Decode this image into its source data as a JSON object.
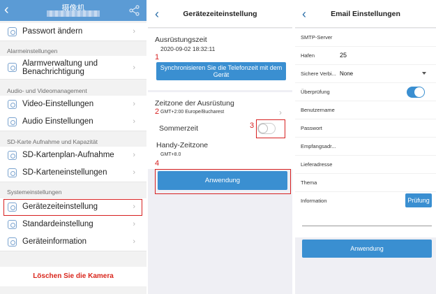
{
  "camera_settings": {
    "header": {
      "title": "摄像机",
      "back_icon": "chevron-left-icon",
      "share_icon": "share-icon",
      "color": "#5b9bd5"
    },
    "change_password": "Passwort ändern",
    "sections": {
      "alarm": "Alarmeinstellungen",
      "av": "Audio- und Videomanagement",
      "sd": "SD-Karte Aufnahme und Kapazität",
      "system": "Systemeinstellungen"
    },
    "items": {
      "alarm_management": "Alarmverwaltung und Benachrichtigung",
      "video_settings": "Video-Einstellungen",
      "audio_settings": "Audio Einstellungen",
      "sd_recording_plan": "SD-Kartenplan-Aufnahme",
      "sd_card_settings": "SD-Karteneinstellungen",
      "device_time_setting": "Gerätezeiteinstellung",
      "default_setting": "Standardeinstellung",
      "device_info": "Geräteinformation"
    },
    "delete_camera": "Löschen Sie die Kamera"
  },
  "device_time": {
    "header": {
      "title": "Gerätezeiteinstellung"
    },
    "equipment_time_label": "Ausrüstungszeit",
    "equipment_time_value": "2020-09-02 18:32:11",
    "sync_button": "Synchronisieren Sie die Telefonzeit mit dem Gerät",
    "timezone_label": "Zeitzone der Ausrüstung",
    "timezone_value": "GMT+2:00 Europe/Bucharest",
    "dst_label": "Sommerzeit",
    "dst_on": false,
    "phone_timezone_label": "Handy-Zeitzone",
    "phone_timezone_value": "GMT+8.0",
    "apply_button": "Anwendung",
    "markers": [
      "1",
      "2",
      "3",
      "4"
    ],
    "accent_color": "#3a8fd1",
    "marker_color": "#d72020"
  },
  "email_settings": {
    "header": {
      "title": "Email Einstellungen"
    },
    "fields": {
      "smtp_server": {
        "label": "SMTP-Server",
        "value": ""
      },
      "port": {
        "label": "Hafen",
        "value": "25"
      },
      "secure": {
        "label": "Sichere Verbi...",
        "value": "None"
      },
      "auth": {
        "label": "Überprüfung",
        "on": true
      },
      "username": {
        "label": "Benutzername",
        "value": ""
      },
      "password": {
        "label": "Passwort",
        "value": ""
      },
      "recipient": {
        "label": "Empfangsadr...",
        "value": ""
      },
      "delivery": {
        "label": "Lieferadresse",
        "value": ""
      },
      "subject": {
        "label": "Thema",
        "value": ""
      },
      "info": {
        "label": "Information",
        "value": ""
      }
    },
    "test_button": "Prüfung",
    "apply_button": "Anwendung",
    "accent_color": "#3a8fd1"
  }
}
